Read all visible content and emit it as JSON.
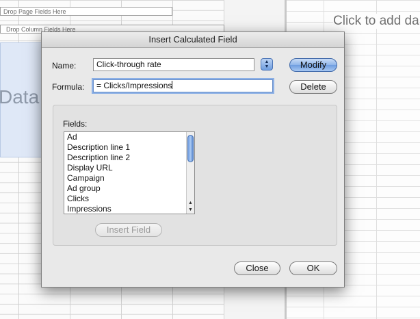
{
  "background": {
    "drop_page_fields": "Drop Page Fields Here",
    "drop_column_fields": "Drop Column Fields Here",
    "data_area_text": "Data",
    "right_pane_title": "Click to add da"
  },
  "dialog": {
    "title": "Insert Calculated Field",
    "name_label": "Name:",
    "name_value": "Click-through rate",
    "formula_label": "Formula:",
    "formula_value": "= Clicks/Impressions",
    "modify_label": "Modify",
    "delete_label": "Delete",
    "fields_label": "Fields:",
    "fields": [
      "Ad",
      "Description line 1",
      "Description line 2",
      "Display URL",
      "Campaign",
      "Ad group",
      "Clicks",
      "Impressions"
    ],
    "insert_field_label": "Insert Field",
    "close_label": "Close",
    "ok_label": "OK"
  },
  "icons": {
    "stepper": "up-down-arrows-icon"
  },
  "colors": {
    "accent": "#6f9de0",
    "focus_ring": "#8cb0e6"
  }
}
